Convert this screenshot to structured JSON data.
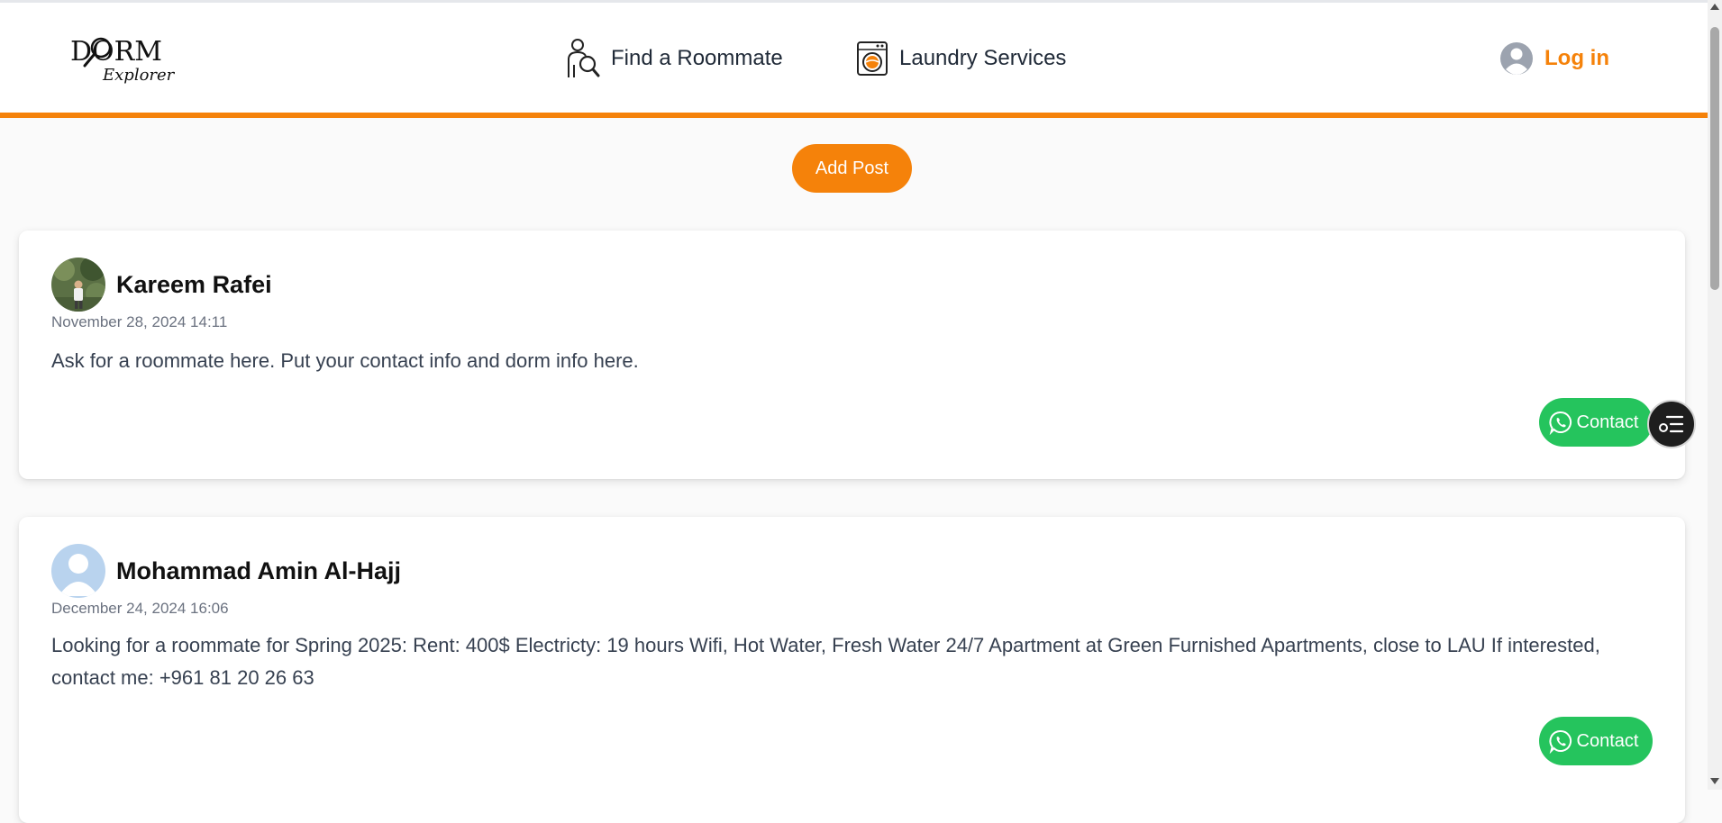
{
  "brand": {
    "logo_text_main": "DORM",
    "logo_text_sub": "Explorer",
    "accent_color": "#f5820a"
  },
  "nav": {
    "items": [
      {
        "label": "Find a Roommate",
        "icon": "roommate-search-icon"
      },
      {
        "label": "Laundry Services",
        "icon": "washing-machine-icon"
      }
    ],
    "login_label": "Log in",
    "login_icon": "user-avatar-icon"
  },
  "actions": {
    "add_post_label": "Add Post"
  },
  "posts": [
    {
      "author": "Kareem Rafei",
      "date": "November 28, 2024 14:11",
      "text": "Ask for a roommate here. Put your contact info and dorm info here.",
      "contact_label": "Contact",
      "avatar": "photo"
    },
    {
      "author": "Mohammad Amin Al-Hajj",
      "date": "December 24, 2024 16:06",
      "text": "Looking for a roommate for Spring 2025: Rent: 400$ Electricty: 19 hours Wifi, Hot Water, Fresh Water 24/7 Apartment at Green Furnished Apartments, close to LAU If interested, contact me: +961 81 20 26 63",
      "contact_label": "Contact",
      "avatar": "default-user"
    }
  ],
  "colors": {
    "contact_green": "#25c45d",
    "fab_dark": "#1e1e1e"
  }
}
